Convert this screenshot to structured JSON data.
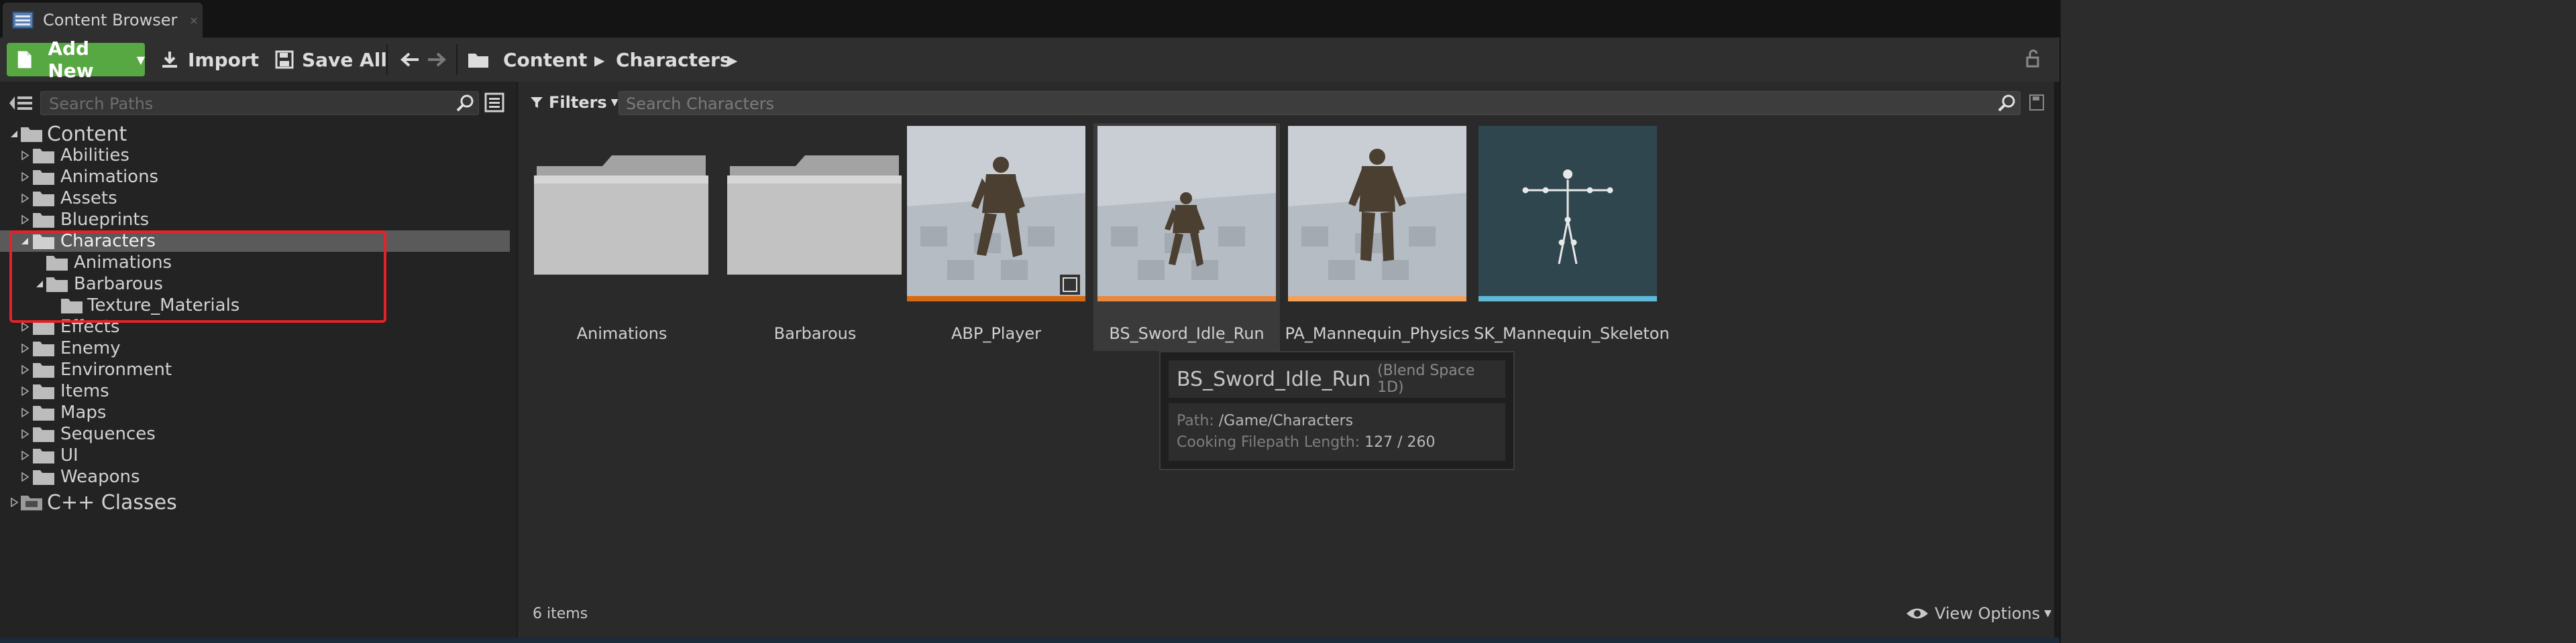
{
  "window": {
    "tab_title": "Content Browser",
    "tab_close_glyph": "×"
  },
  "toolbar": {
    "add_new_label": "Add New",
    "import_label": "Import",
    "save_all_label": "Save All",
    "breadcrumbs": [
      "Content",
      "Characters"
    ]
  },
  "sources_panel": {
    "search_placeholder": "Search Paths",
    "tree": [
      {
        "label": "Content",
        "depth": 0,
        "expanded": true
      },
      {
        "label": "Abilities",
        "depth": 1
      },
      {
        "label": "Animations",
        "depth": 1
      },
      {
        "label": "Assets",
        "depth": 1
      },
      {
        "label": "Blueprints",
        "depth": 1
      },
      {
        "label": "Characters",
        "depth": 1,
        "expanded": true,
        "selected": true
      },
      {
        "label": "Animations",
        "depth": 2
      },
      {
        "label": "Barbarous",
        "depth": 2,
        "expanded": true
      },
      {
        "label": "Texture_Materials",
        "depth": 3
      },
      {
        "label": "Effects",
        "depth": 1
      },
      {
        "label": "Enemy",
        "depth": 1
      },
      {
        "label": "Environment",
        "depth": 1
      },
      {
        "label": "Items",
        "depth": 1
      },
      {
        "label": "Maps",
        "depth": 1
      },
      {
        "label": "Sequences",
        "depth": 1
      },
      {
        "label": "UI",
        "depth": 1
      },
      {
        "label": "Weapons",
        "depth": 1
      },
      {
        "label": "C++ Classes",
        "depth": 0
      }
    ]
  },
  "asset_panel": {
    "filters_label": "Filters",
    "search_placeholder": "Search Characters",
    "assets": [
      {
        "name": "Animations",
        "kind": "folder"
      },
      {
        "name": "Barbarous",
        "kind": "folder"
      },
      {
        "name": "ABP_Player",
        "kind": "animation-blueprint",
        "bar_color": "#d66a12"
      },
      {
        "name": "BS_Sword_Idle_Run",
        "kind": "blend-space",
        "bar_color": "#e8893f"
      },
      {
        "name": "PA_Mannequin_Physics",
        "kind": "physics-asset",
        "bar_color": "#f3a05c"
      },
      {
        "name": "SK_Mannequin_Skeleton",
        "kind": "skeleton",
        "bar_color": "#5fb8d6"
      }
    ],
    "item_count": "6 items",
    "view_options_label": "View Options"
  },
  "tooltip": {
    "name": "BS_Sword_Idle_Run",
    "type": "(Blend Space 1D)",
    "path_key": "Path:",
    "path_value": "/Game/Characters",
    "length_key": "Cooking Filepath Length:",
    "length_value": "127 / 260"
  },
  "colors": {
    "add_new_green": "#57a742",
    "selection_highlight": "#e2232a"
  }
}
